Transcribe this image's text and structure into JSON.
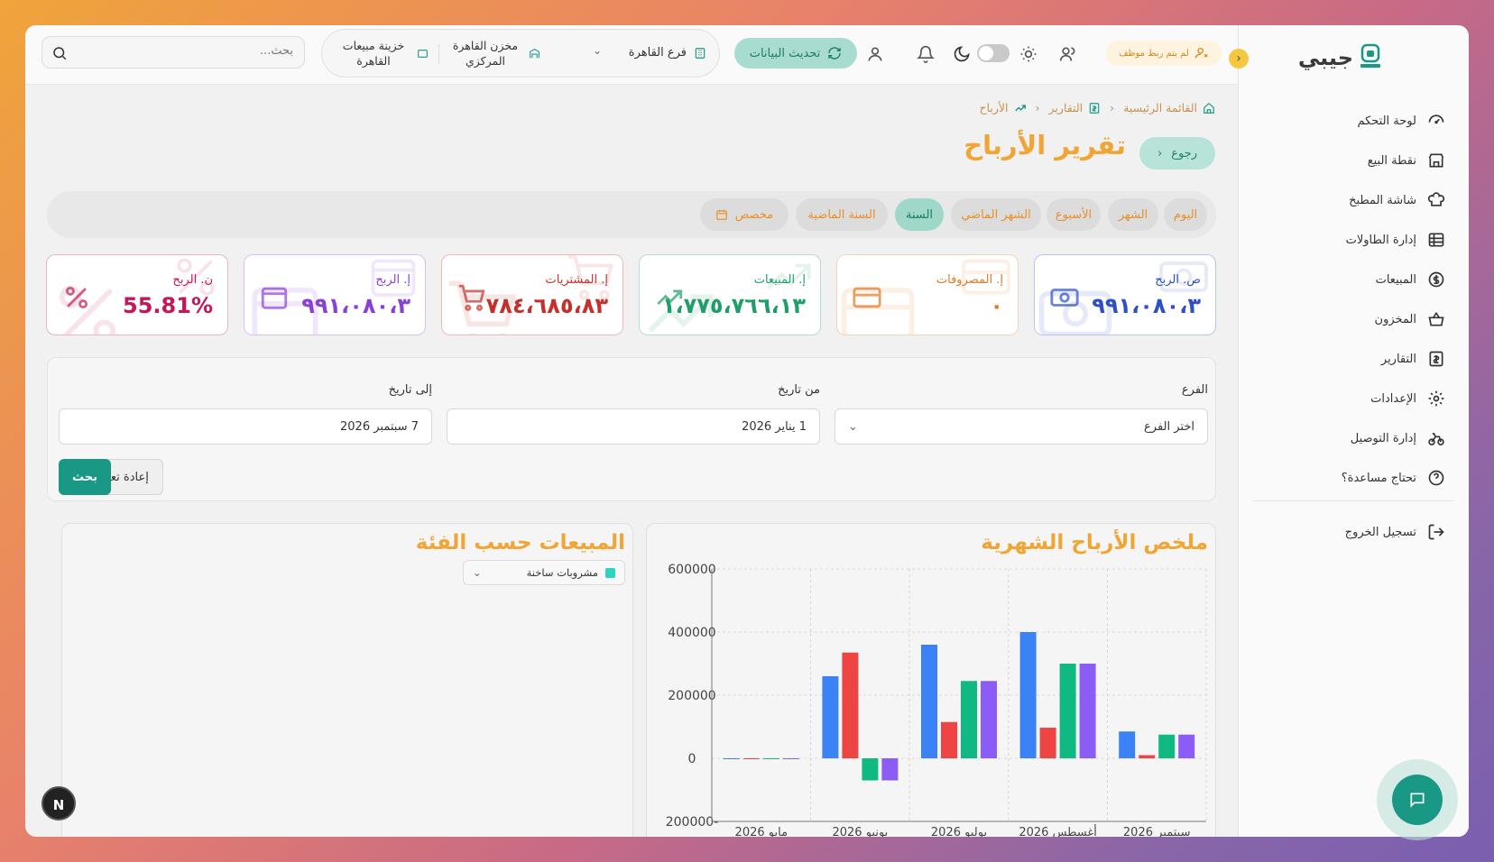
{
  "app": {
    "brand": "جيبي",
    "collapse_icon": "chevron-left-icon"
  },
  "sidebar": {
    "items": [
      {
        "label": "لوحة التحكم",
        "icon": "gauge-icon"
      },
      {
        "label": "نقطة البيع",
        "icon": "store-icon"
      },
      {
        "label": "شاشة المطبخ",
        "icon": "chef-hat-icon"
      },
      {
        "label": "إدارة الطاولات",
        "icon": "table-icon"
      },
      {
        "label": "المبيعات",
        "icon": "dollar-circle-icon"
      },
      {
        "label": "المخزون",
        "icon": "basket-icon"
      },
      {
        "label": "التقارير",
        "icon": "report-icon"
      },
      {
        "label": "الإعدادات",
        "icon": "gear-icon"
      },
      {
        "label": "إدارة التوصيل",
        "icon": "bike-icon"
      },
      {
        "label": "تحتاج مساعدة؟",
        "icon": "help-icon"
      }
    ],
    "logout": "تسجيل الخروج"
  },
  "topbar": {
    "employee_badge": "لم يتم ربط موظف",
    "refresh_label": "تحديث البيانات",
    "branch": "فرع القاهرة",
    "store": "مخزن القاهرة المركزي",
    "safe": "خزينة مبيعات القاهرة",
    "search_placeholder": "بحث..."
  },
  "breadcrumb": {
    "home": "القائمة الرئيسية",
    "reports": "التقارير",
    "current": "الأرباح"
  },
  "page": {
    "title": "تقرير الأرباح",
    "back": "رجوع"
  },
  "periods": [
    {
      "label": "اليوم",
      "active": false
    },
    {
      "label": "الشهر",
      "active": false
    },
    {
      "label": "الأسبوع",
      "active": false
    },
    {
      "label": "الشهر الماضي",
      "active": false
    },
    {
      "label": "السنة",
      "active": true
    },
    {
      "label": "السنة الماضية",
      "active": false
    },
    {
      "label": "مخصص",
      "active": false
    }
  ],
  "cards": [
    {
      "label": "ص. الربح",
      "value": "٩٩١،٠٨٠،٣",
      "color": "#2f4fc4",
      "icon": "money-icon"
    },
    {
      "label": "إ. المصروفات",
      "value": "٠",
      "color": "#e07a22",
      "icon": "credit-card-icon"
    },
    {
      "label": "إ. المبيعات",
      "value": "١،٧٧٥،٧٦٦،١٣",
      "color": "#1f9e6a",
      "icon": "trending-up-icon"
    },
    {
      "label": "إ. المشتريات",
      "value": "٧٨٤،٦٨٥،٨٣",
      "color": "#c4302b",
      "icon": "cart-icon"
    },
    {
      "label": "إ. الربح",
      "value": "٩٩١،٠٨٠،٣",
      "color": "#8a3fd6",
      "icon": "wallet-icon"
    },
    {
      "label": "ن. الربح",
      "value": "55.81%",
      "color": "#c2185b",
      "icon": "percent-icon"
    }
  ],
  "filters": {
    "branch_label": "الفرع",
    "branch_value": "اختر الفرع",
    "from_label": "من تاريخ",
    "from_value": "1 يناير 2026",
    "to_label": "إلى تاريخ",
    "to_value": "7 سبتمبر 2026",
    "search_btn": "بحث",
    "reset_btn": "إعادة تعيين"
  },
  "monthly_panel": {
    "title": "ملخص الأرباح الشهرية"
  },
  "category_panel": {
    "title": "المبيعات حسب الفئة",
    "selected": "مشروبات ساخنة"
  },
  "chart_data": {
    "type": "bar",
    "categories": [
      "مايو 2026",
      "يونيو 2026",
      "يوليو 2026",
      "أغسطس 2026",
      "سبتمبر 2026"
    ],
    "series": [
      {
        "values": [
          0,
          260000,
          360000,
          400000,
          85000
        ],
        "color": "#3b82f6"
      },
      {
        "values": [
          0,
          335000,
          115000,
          97000,
          10000
        ],
        "color": "#ef4444"
      },
      {
        "values": [
          0,
          -70000,
          245000,
          300000,
          75000
        ],
        "color": "#10b981"
      },
      {
        "values": [
          0,
          -70000,
          245000,
          300000,
          75000
        ],
        "color": "#8b5cf6"
      }
    ],
    "yticks": [
      "600000",
      "400000",
      "200000",
      "0",
      "-200000"
    ],
    "ylim": [
      -200000,
      600000
    ],
    "grid": true
  },
  "colors": {
    "accent": "#f0a534",
    "primary": "#1a9886"
  },
  "badge": {
    "next": "N"
  }
}
